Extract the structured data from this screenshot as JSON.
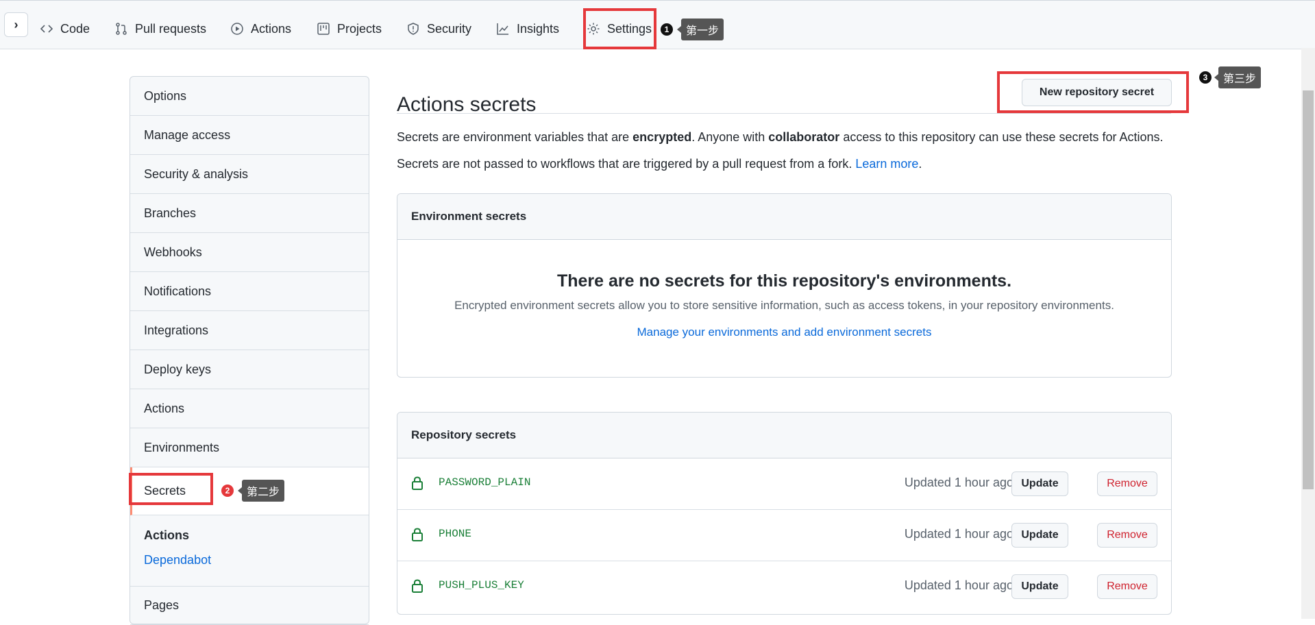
{
  "nav": {
    "tabs": [
      {
        "label": "Code",
        "icon": "code-icon"
      },
      {
        "label": "Pull requests",
        "icon": "pull-request-icon"
      },
      {
        "label": "Actions",
        "icon": "play-icon"
      },
      {
        "label": "Projects",
        "icon": "project-icon"
      },
      {
        "label": "Security",
        "icon": "shield-icon"
      },
      {
        "label": "Insights",
        "icon": "graph-icon"
      },
      {
        "label": "Settings",
        "icon": "gear-icon"
      }
    ]
  },
  "annotations": {
    "step1": {
      "num": "1",
      "text": "第一步"
    },
    "step2": {
      "num": "2",
      "text": "第二步"
    },
    "step3": {
      "num": "3",
      "text": "第三步"
    }
  },
  "menu": {
    "items": [
      "Options",
      "Manage access",
      "Security & analysis",
      "Branches",
      "Webhooks",
      "Notifications",
      "Integrations",
      "Deploy keys",
      "Actions",
      "Environments",
      "Secrets"
    ],
    "active": "Secrets",
    "subheading": "Actions",
    "sublink": "Dependabot",
    "pages": "Pages"
  },
  "main": {
    "title": "Actions secrets",
    "new_button": "New repository secret",
    "p1": {
      "a": "Secrets are environment variables that are ",
      "b": "encrypted",
      "c": ". Anyone with ",
      "d": "collaborator",
      "e": " access to this repository can use these secrets for Actions."
    },
    "p2": {
      "a": "Secrets are not passed to workflows that are triggered by a pull request from a fork. ",
      "link": "Learn more",
      "end": "."
    },
    "env": {
      "header": "Environment secrets",
      "blank_title": "There are no secrets for this repository's environments.",
      "blank_desc": "Encrypted environment secrets allow you to store sensitive information, such as access tokens, in your repository environments.",
      "blank_link": "Manage your environments and add environment secrets"
    },
    "repo": {
      "header": "Repository secrets",
      "update_label": "Update",
      "remove_label": "Remove",
      "secrets": [
        {
          "name": "PASSWORD_PLAIN",
          "updated": "Updated 1 hour ago"
        },
        {
          "name": "PHONE",
          "updated": "Updated 1 hour ago"
        },
        {
          "name": "PUSH_PLUS_KEY",
          "updated": "Updated 1 hour ago"
        }
      ]
    }
  },
  "colors": {
    "accent_link": "#0969da",
    "danger": "#cf222e",
    "highlight": "#e5383b",
    "secret_green": "#1a7f37"
  }
}
